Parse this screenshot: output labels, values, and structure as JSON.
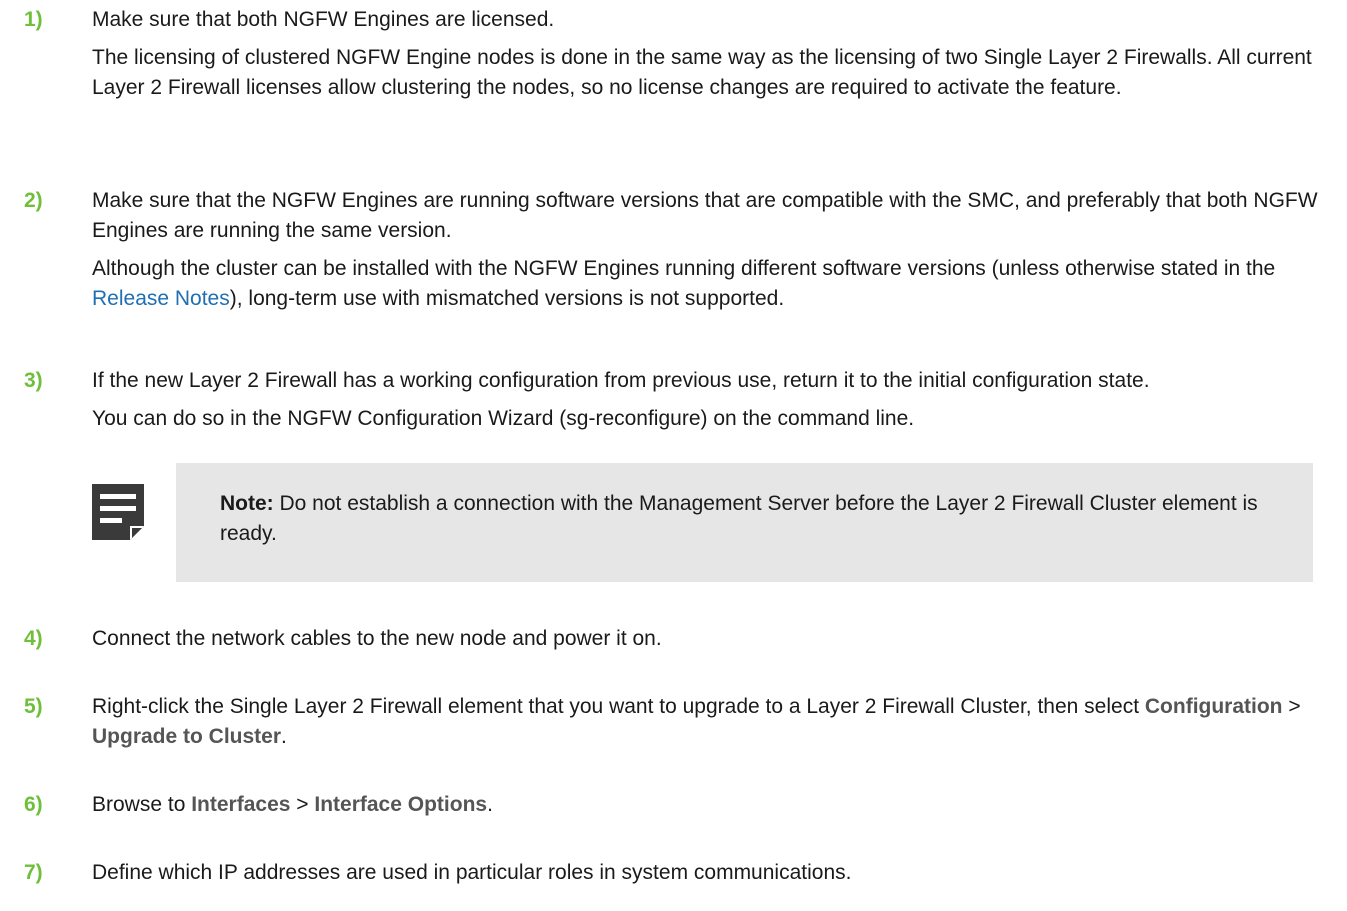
{
  "steps": [
    {
      "number": "1)",
      "main": "Make sure that both NGFW Engines are licensed.",
      "detail": "The licensing of clustered NGFW Engine nodes is done in the same way as the licensing of two Single Layer 2 Firewalls. All current Layer 2 Firewall licenses allow clustering the nodes, so no license changes are required to activate the feature."
    },
    {
      "number": "2)",
      "main": "Make sure that the NGFW Engines are running software versions that are compatible with the SMC, and preferably that both NGFW Engines are running the same version.",
      "detail_before": "Although the cluster can be installed with the NGFW Engines running different software versions (unless otherwise stated in the ",
      "detail_link": "Release Notes",
      "detail_after": "), long-term use with mismatched versions is not supported."
    },
    {
      "number": "3)",
      "main": "If the new Layer 2 Firewall has a working configuration from previous use, return it to the initial configuration state.",
      "detail": "You can do so in the NGFW Configuration Wizard (sg-reconfigure) on the command line.",
      "note_label": "Note:",
      "note_text": " Do not establish a connection with the Management Server before the Layer 2 Firewall Cluster element is ready."
    },
    {
      "number": "4)",
      "main": "Connect the network cables to the new node and power it on."
    },
    {
      "number": "5)",
      "main_before": "Right-click the Single Layer 2 Firewall element that you want to upgrade to a Layer 2 Firewall Cluster, then select ",
      "ui1": "Configuration",
      "sep": " > ",
      "ui2": "Upgrade to Cluster",
      "end": "."
    },
    {
      "number": "6)",
      "main_before": "Browse to ",
      "ui1": "Interfaces",
      "sep": " > ",
      "ui2": "Interface Options",
      "end": "."
    },
    {
      "number": "7)",
      "main": "Define which IP addresses are used in particular roles in system communications."
    }
  ],
  "icons": {
    "note": "note-icon"
  },
  "colors": {
    "step_number": "#6fbf3b",
    "link": "#1f6fb2",
    "note_background": "#e6e6e6",
    "ui_text": "#555555"
  }
}
